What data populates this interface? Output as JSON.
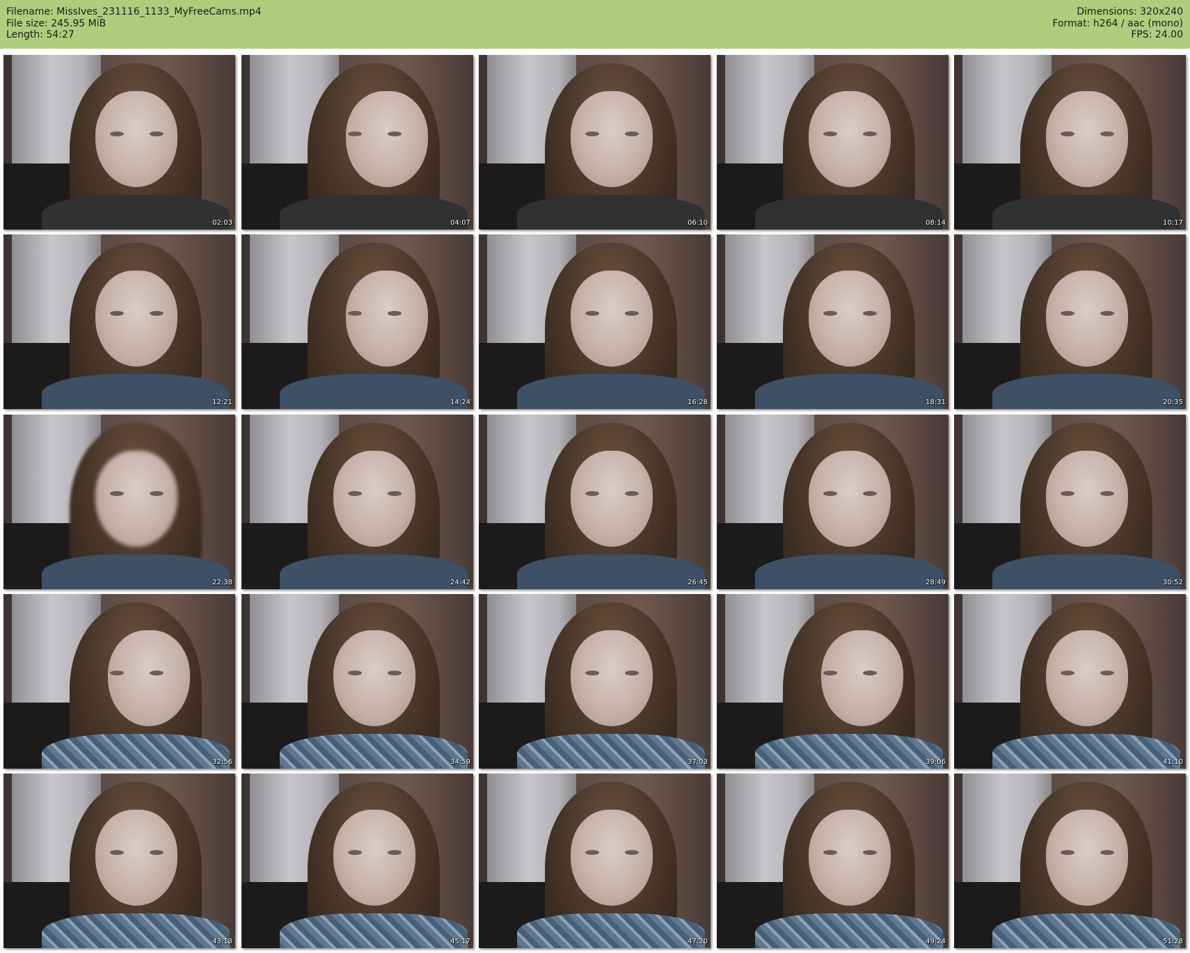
{
  "header": {
    "filename": "Filename: MissIves_231116_1133_MyFreeCams.mp4",
    "filesize": "File size: 245.95 MiB",
    "length": "Length: 54:27",
    "dimensions": "Dimensions: 320x240",
    "format": "Format: h264 / aac (mono)",
    "fps": "FPS: 24.00"
  },
  "colors": {
    "header_bg": "#b0cd7e"
  },
  "thumbnails": [
    {
      "time": "02:03"
    },
    {
      "time": "04:07"
    },
    {
      "time": "06:10"
    },
    {
      "time": "08:14"
    },
    {
      "time": "10:17"
    },
    {
      "time": "12:21"
    },
    {
      "time": "14:24"
    },
    {
      "time": "16:28"
    },
    {
      "time": "18:31"
    },
    {
      "time": "20:35"
    },
    {
      "time": "22:38"
    },
    {
      "time": "24:42"
    },
    {
      "time": "26:45"
    },
    {
      "time": "28:49"
    },
    {
      "time": "30:52"
    },
    {
      "time": "32:56"
    },
    {
      "time": "34:59"
    },
    {
      "time": "37:03"
    },
    {
      "time": "39:06"
    },
    {
      "time": "41:10"
    },
    {
      "time": "43:13"
    },
    {
      "time": "45:17"
    },
    {
      "time": "47:20"
    },
    {
      "time": "49:24"
    },
    {
      "time": "51:28"
    }
  ]
}
